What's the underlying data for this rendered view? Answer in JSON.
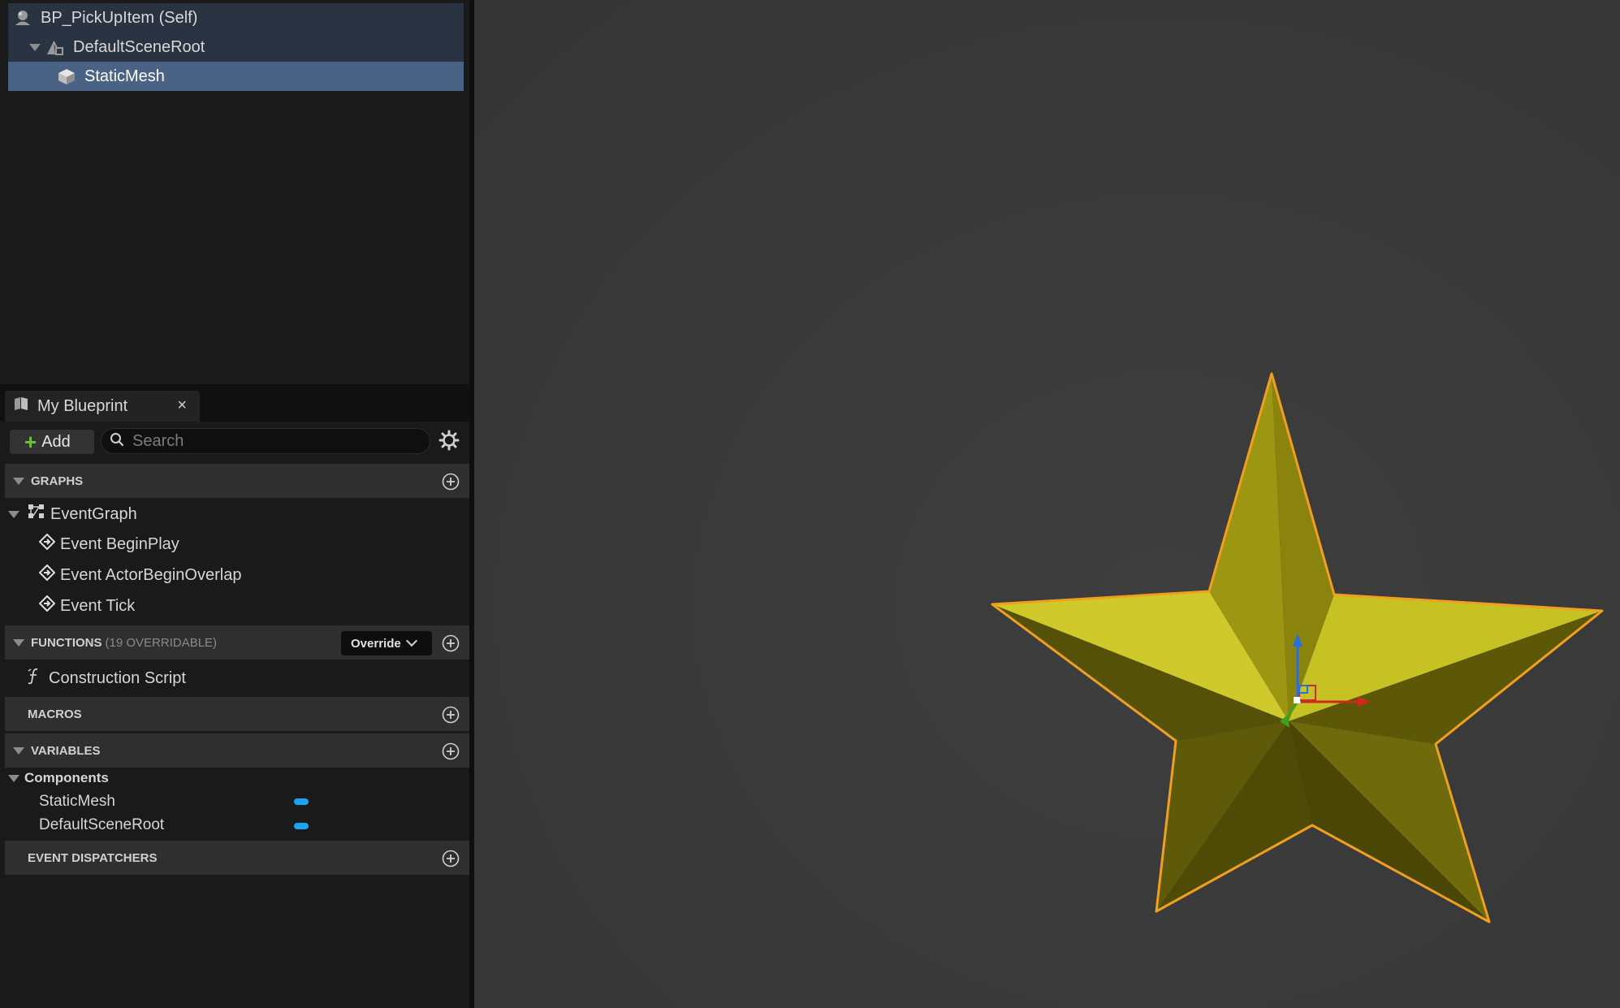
{
  "components": {
    "items": [
      {
        "label": "BP_PickUpItem (Self)",
        "icon": "actor-icon"
      },
      {
        "label": "DefaultSceneRoot",
        "icon": "scene-root-icon"
      },
      {
        "label": "StaticMesh",
        "icon": "static-mesh-icon"
      }
    ],
    "selected": "StaticMesh"
  },
  "my_blueprint": {
    "tab_label": "My Blueprint",
    "close_glyph": "×",
    "add_label": "Add",
    "search_placeholder": "Search",
    "sections": {
      "graphs": "GRAPHS",
      "functions": "FUNCTIONS",
      "functions_sub": "(19 OVERRIDABLE)",
      "override_label": "Override",
      "macros": "MACROS",
      "variables": "VARIABLES",
      "dispatchers": "EVENT DISPATCHERS"
    },
    "graphs": {
      "event_graph": "EventGraph",
      "events": [
        "Event BeginPlay",
        "Event ActorBeginOverlap",
        "Event Tick"
      ]
    },
    "functions": [
      "Construction Script"
    ],
    "variables": {
      "category": "Components",
      "items": [
        "StaticMesh",
        "DefaultSceneRoot"
      ],
      "type_color": "#1aa3f0"
    }
  },
  "viewport": {
    "object": "star",
    "background": "#3a3a3a",
    "selection_outline": "#f0a01e",
    "mesh_color": "#b5ae12"
  }
}
